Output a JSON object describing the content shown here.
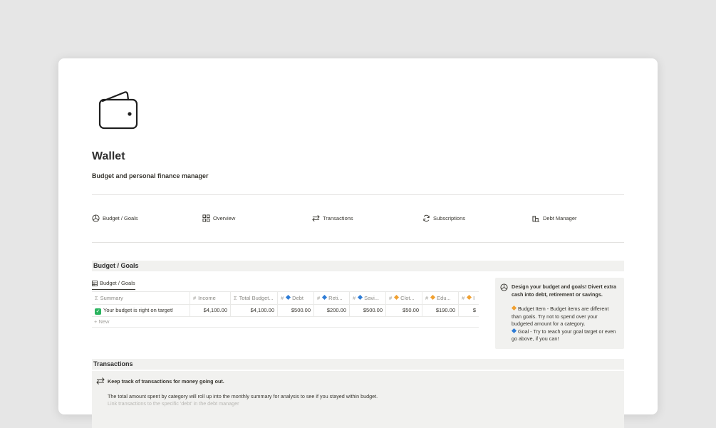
{
  "page": {
    "title": "Wallet",
    "subtitle": "Budget and personal finance manager",
    "icon": "wallet-icon"
  },
  "nav": [
    {
      "label": "Budget / Goals",
      "icon": "pie-chart-icon"
    },
    {
      "label": "Overview",
      "icon": "grid-icon"
    },
    {
      "label": "Transactions",
      "icon": "arrows-exchange-icon"
    },
    {
      "label": "Subscriptions",
      "icon": "refresh-icon"
    },
    {
      "label": "Debt Manager",
      "icon": "building-icon"
    }
  ],
  "budget_section": {
    "header": "Budget / Goals",
    "view_tab": "Budget / Goals",
    "columns": [
      {
        "icon": "Σ",
        "label": "Summary"
      },
      {
        "icon": "#",
        "label": "Income"
      },
      {
        "icon": "Σ",
        "label": "Total Budget..."
      },
      {
        "icon": "#",
        "label": "Debt",
        "diamond": "blue"
      },
      {
        "icon": "#",
        "label": "Reti...",
        "diamond": "blue"
      },
      {
        "icon": "#",
        "label": "Savi...",
        "diamond": "blue"
      },
      {
        "icon": "#",
        "label": "Clot...",
        "diamond": "orange"
      },
      {
        "icon": "#",
        "label": "Edu...",
        "diamond": "orange"
      },
      {
        "icon": "#",
        "label": "I",
        "diamond": "orange"
      }
    ],
    "row": {
      "summary": "Your budget is right on target!",
      "values": [
        "$4,100.00",
        "$4,100.00",
        "$500.00",
        "$200.00",
        "$500.00",
        "$50.00",
        "$190.00",
        "$"
      ]
    },
    "new_label": "+ New",
    "callout": {
      "title": "Design your budget and goals! Divert extra cash into debt, retirement or savings.",
      "item1": "Budget Item - Budget items are different than goals. Try not to spend over your budgeted amount for a category.",
      "item2": "Goal - Try to reach your goal target or even go above, if you can!"
    }
  },
  "transactions_section": {
    "header": "Transactions",
    "callout_title": "Keep track of transactions for money going out.",
    "callout_body": "The total amount spent by category will roll up into the monthly summary for analysis to see if you stayed within budget.",
    "callout_faded": "Link transactions to the specific 'debt' in the debt manager"
  },
  "colors": {
    "background": "#e6e6e6",
    "card": "#ffffff",
    "section_header": "#f1f1ef",
    "text": "#37352f",
    "blue_diamond": "#2e7cd6",
    "orange_diamond": "#f0a030",
    "check_green": "#2bb45f"
  }
}
